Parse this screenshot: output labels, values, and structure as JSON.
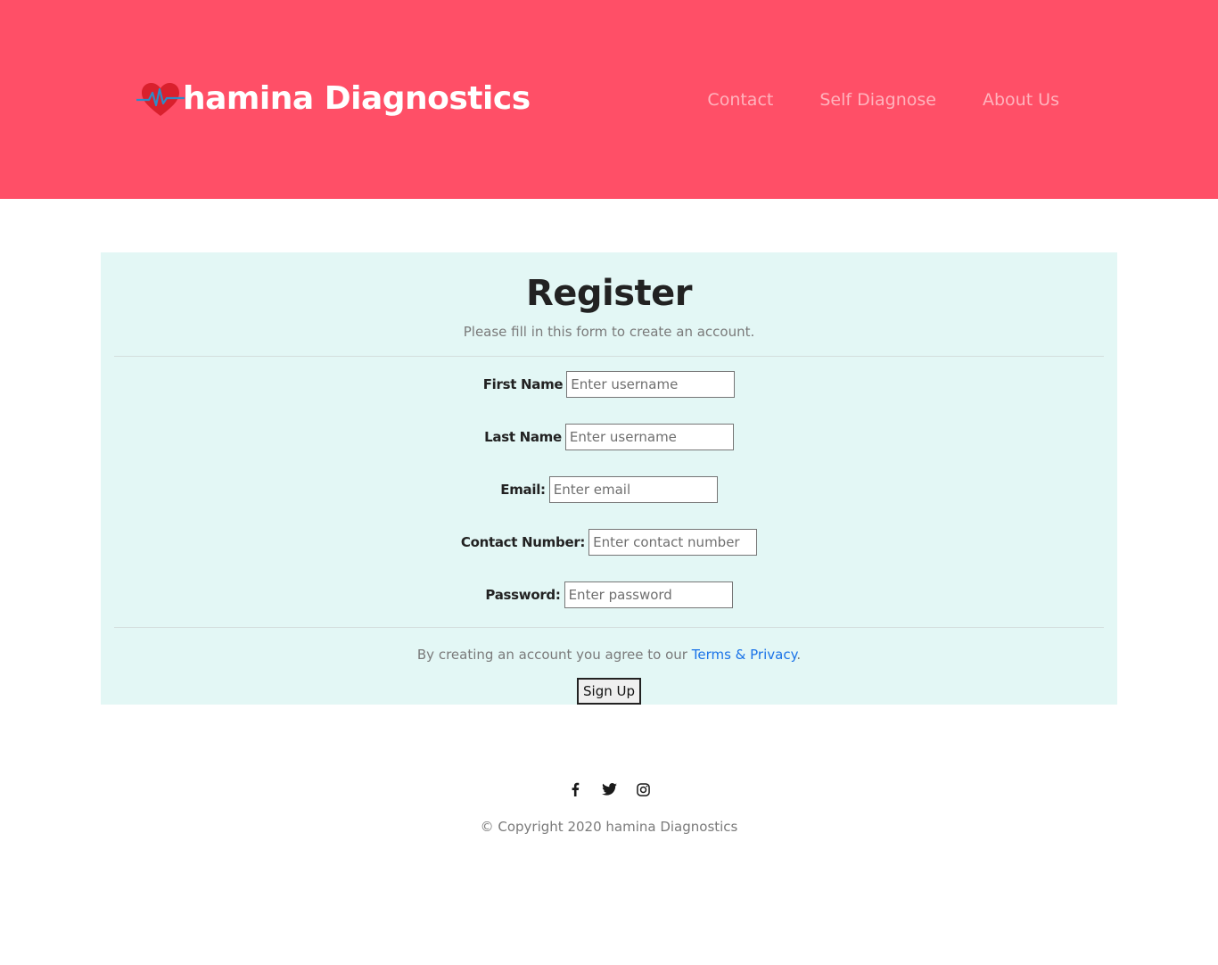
{
  "header": {
    "brand_name": "hamina Diagnostics",
    "logo_icon": "heart-pulse-icon",
    "background_color": "#ff4f67",
    "nav": [
      {
        "label": "Contact"
      },
      {
        "label": "Self Diagnose"
      },
      {
        "label": "About Us"
      }
    ]
  },
  "register": {
    "title": "Register",
    "subtitle": "Please fill in this form to create an account.",
    "background_color": "#e3f7f5",
    "fields": [
      {
        "label": "First Name",
        "placeholder": "Enter username",
        "value": ""
      },
      {
        "label": "Last Name",
        "placeholder": "Enter username",
        "value": ""
      },
      {
        "label": "Email:",
        "placeholder": "Enter email",
        "value": ""
      },
      {
        "label": "Contact Number:",
        "placeholder": "Enter contact number",
        "value": ""
      },
      {
        "label": "Password:",
        "placeholder": "Enter password",
        "value": ""
      }
    ],
    "terms_prefix": "By creating an account you agree to our ",
    "terms_link": "Terms & Privacy",
    "terms_suffix": ".",
    "submit_label": "Sign Up"
  },
  "footer": {
    "social": [
      {
        "icon": "facebook-icon"
      },
      {
        "icon": "twitter-icon"
      },
      {
        "icon": "instagram-icon"
      }
    ],
    "copyright": "© Copyright 2020 hamina Diagnostics"
  }
}
